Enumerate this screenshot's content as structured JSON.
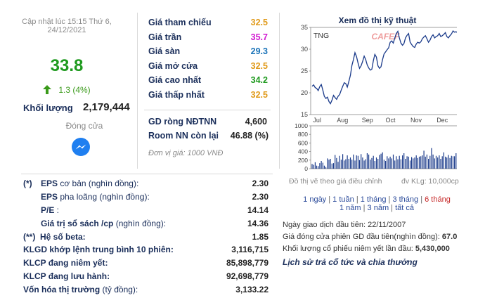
{
  "summary": {
    "updated": "Cập nhật lúc 15:15 Thứ 6,",
    "updated_date": "24/12/2021",
    "price": "33.8",
    "change": "1.3 (4%)",
    "volume_label": "Khối lượng",
    "volume_value": "2,179,444",
    "status": "Đóng cửa",
    "colors": {
      "up": "#3a9a1a",
      "price": "#1f9a1f"
    }
  },
  "prices": {
    "rows": [
      {
        "label": "Giá tham chiếu",
        "value": "32.5",
        "color": "#e09a1a"
      },
      {
        "label": "Giá trần",
        "value": "35.7",
        "color": "#d21bd2"
      },
      {
        "label": "Giá sàn",
        "value": "29.3",
        "color": "#1a73b8"
      },
      {
        "label": "Giá mở cửa",
        "value": "32.5",
        "color": "#e09a1a"
      },
      {
        "label": "Giá cao nhất",
        "value": "34.2",
        "color": "#1f9a1f"
      },
      {
        "label": "Giá thấp nhất",
        "value": "32.5",
        "color": "#e09a1a"
      }
    ],
    "gd_rong_label": "GD ròng NĐTNN",
    "gd_rong_value": "4,600",
    "room_label": "Room NN còn lại",
    "room_value": "46.88 (%)",
    "unit_note": "Đơn vị giá: 1000 VNĐ"
  },
  "fundamentals": {
    "rows": [
      {
        "prefix": "(*)",
        "label": "EPS",
        "suffix": " cơ bản (nghìn đồng):",
        "value": "2.30"
      },
      {
        "prefix": "",
        "label": "EPS",
        "suffix": " pha loãng (nghìn đồng):",
        "value": "2.30"
      },
      {
        "prefix": "",
        "label": "P/E",
        "suffix": " :",
        "value": "14.14"
      },
      {
        "prefix": "",
        "label": "Giá trị sổ sách /cp",
        "suffix": " (nghìn đồng):",
        "value": "14.36"
      },
      {
        "prefix": "(**)",
        "label": "Hệ số beta:",
        "suffix": "",
        "value": "1.85"
      },
      {
        "prefix": "",
        "label": "KLGD khớp lệnh trung bình 10 phiên:",
        "suffix": "",
        "value": "3,116,715"
      },
      {
        "prefix": "",
        "label": "KLCP đang niêm yết:",
        "suffix": "",
        "value": "85,898,779"
      },
      {
        "prefix": "",
        "label": "KLCP đang lưu hành:",
        "suffix": "",
        "value": "92,698,779"
      },
      {
        "prefix": "",
        "label": "Vốn hóa thị trường",
        "suffix": " (tỷ đồng):",
        "value": "3,133.22"
      }
    ]
  },
  "chart_panel": {
    "title": "Xem đồ thị kỹ thuật",
    "ticker": "TNG",
    "watermark": "CAFEF",
    "note": "Đồ thị vẽ theo giá điều chỉnh",
    "vol_unit": "đv KLg: 10,000cp",
    "ranges_row1": [
      "1 ngày",
      "1 tuần",
      "1 tháng",
      "3 tháng",
      "6 tháng"
    ],
    "ranges_row2": [
      "1 năm",
      "3 năm",
      "tất cả"
    ],
    "active_range": "6 tháng"
  },
  "listing": {
    "first_trade": "Ngày giao dịch đầu tiên: 22/11/2007",
    "first_price_label": "Giá đóng cửa phiên GD đầu tiên(nghìn đồng):",
    "first_price_value": "67.0",
    "first_volume_label": "Khối lượng cổ phiếu niêm yết lần đầu:",
    "first_volume_value": "5,430,000",
    "history_link": "Lịch sử trả cổ tức và chia thưởng"
  },
  "chart_data": [
    {
      "type": "line",
      "x": [
        "Jul",
        "Aug",
        "Sep",
        "Oct",
        "Nov",
        "Dec"
      ],
      "ylim": [
        15,
        35
      ],
      "yticks": [
        15,
        20,
        25,
        30,
        35
      ],
      "values": [
        21.5,
        21.8,
        21.2,
        21.0,
        20.5,
        21.4,
        21.9,
        20.6,
        19.2,
        18.7,
        19.0,
        18.0,
        17.5,
        18.3,
        19.4,
        18.9,
        18.5,
        19.2,
        19.6,
        20.6,
        21.5,
        22.3,
        22.1,
        21.3,
        22.6,
        24.0,
        26.3,
        27.6,
        29.2,
        28.3,
        26.8,
        25.6,
        26.2,
        27.2,
        28.4,
        27.6,
        26.4,
        25.7,
        25.2,
        25.4,
        27.4,
        28.8,
        28.2,
        26.2,
        25.6,
        26.0,
        27.6,
        28.9,
        29.4,
        29.9,
        30.3,
        31.6,
        31.9,
        31.4,
        32.6,
        33.6,
        34.1,
        32.6,
        31.4,
        30.9,
        31.3,
        32.6,
        33.2,
        33.6,
        31.6,
        31.1,
        30.6,
        30.4,
        31.2,
        31.6,
        31.4,
        31.7,
        32.4,
        32.8,
        33.1,
        32.4,
        31.6,
        32.1,
        32.9,
        33.3,
        32.6,
        32.9,
        33.1,
        33.6,
        32.9,
        33.1,
        33.4,
        33.8,
        32.9,
        32.6,
        33.1,
        33.5,
        34.2,
        33.9,
        34.0,
        33.8
      ]
    },
    {
      "type": "bar",
      "ylim": [
        0,
        1000
      ],
      "yticks": [
        0,
        200,
        400,
        600,
        800,
        1000
      ],
      "values": [
        110,
        90,
        150,
        70,
        60,
        130,
        180,
        140,
        70,
        40,
        240,
        210,
        230,
        120,
        130,
        320,
        250,
        160,
        300,
        210,
        340,
        190,
        220,
        310,
        230,
        260,
        210,
        330,
        190,
        310,
        300,
        200,
        340,
        260,
        190,
        220,
        360,
        330,
        210,
        250,
        300,
        180,
        260,
        230,
        320,
        350,
        380,
        210,
        180,
        290,
        240,
        280,
        240,
        330,
        190,
        290,
        220,
        300,
        220,
        310,
        360,
        230,
        290,
        280,
        190,
        270,
        240,
        260,
        310,
        250,
        280,
        290,
        310,
        420,
        280,
        330,
        230,
        300,
        480,
        330,
        240,
        300,
        260,
        310,
        230,
        290,
        380,
        280,
        260,
        320,
        250,
        300,
        290,
        290,
        360,
        260
      ]
    }
  ]
}
